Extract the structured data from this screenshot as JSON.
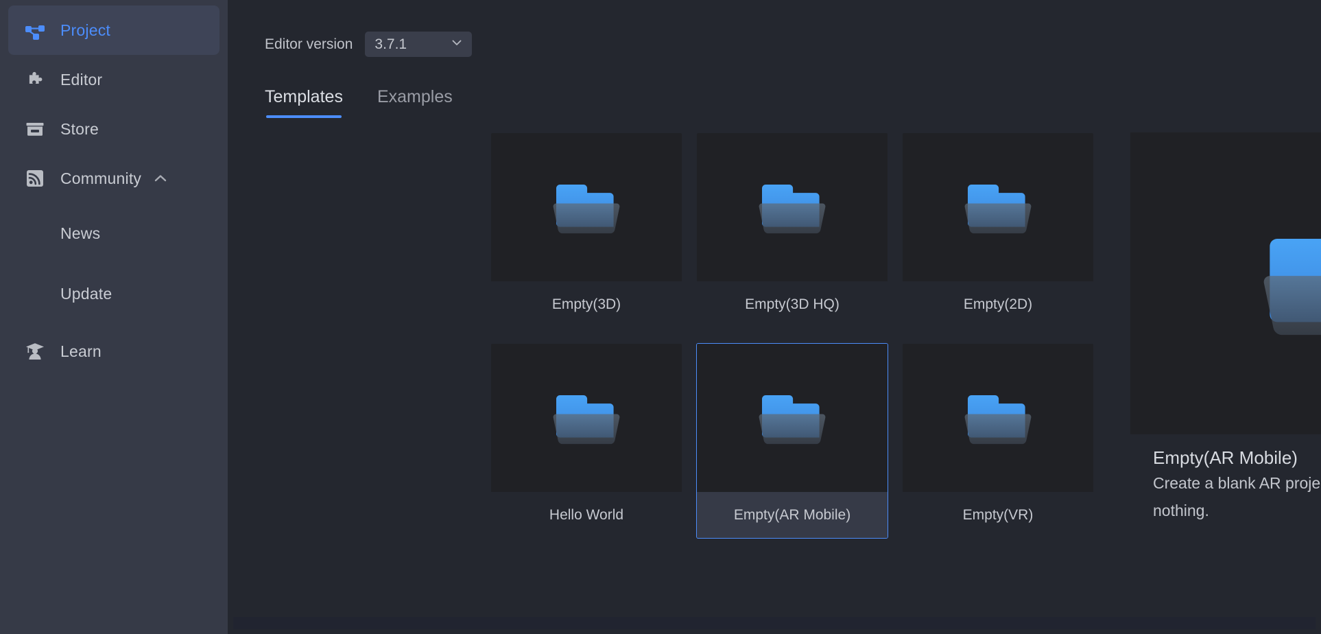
{
  "app": {
    "accent_color": "#4c8dfb",
    "sidebar_bg": "#363a47",
    "main_bg": "#24272f",
    "card_bg": "#202125"
  },
  "sidebar": {
    "items": [
      {
        "id": "project",
        "label": "Project",
        "icon": "node-graph-icon",
        "active": true,
        "sub": false
      },
      {
        "id": "editor",
        "label": "Editor",
        "icon": "puzzle-piece-icon",
        "active": false,
        "sub": false
      },
      {
        "id": "store",
        "label": "Store",
        "icon": "storefront-icon",
        "active": false,
        "sub": false
      },
      {
        "id": "community",
        "label": "Community",
        "icon": "rss-feed-icon",
        "active": false,
        "sub": false,
        "chevron": "chevron-up-icon"
      },
      {
        "id": "news",
        "label": "News",
        "icon": "",
        "active": false,
        "sub": true
      },
      {
        "id": "update",
        "label": "Update",
        "icon": "",
        "active": false,
        "sub": true
      },
      {
        "id": "learn",
        "label": "Learn",
        "icon": "graduate-icon",
        "active": false,
        "sub": false
      }
    ]
  },
  "toolbar": {
    "version_label": "Editor version",
    "version_value": "3.7.1",
    "version_chevron": "chevron-down-icon"
  },
  "tabs": [
    {
      "id": "templates",
      "label": "Templates",
      "active": true
    },
    {
      "id": "examples",
      "label": "Examples",
      "active": false
    }
  ],
  "templates": [
    {
      "id": "empty-3d",
      "label": "Empty(3D)",
      "icon": "folder-icon",
      "selected": false
    },
    {
      "id": "empty-3d-hq",
      "label": "Empty(3D HQ)",
      "icon": "folder-icon",
      "selected": false
    },
    {
      "id": "empty-2d",
      "label": "Empty(2D)",
      "icon": "folder-icon",
      "selected": false
    },
    {
      "id": "hello-world",
      "label": "Hello World",
      "icon": "folder-icon",
      "selected": false
    },
    {
      "id": "empty-ar-mobile",
      "label": "Empty(AR Mobile)",
      "icon": "folder-icon",
      "selected": true
    },
    {
      "id": "empty-vr",
      "label": "Empty(VR)",
      "icon": "folder-icon",
      "selected": false
    }
  ],
  "preview": {
    "icon": "folder-icon",
    "title": "Empty(AR Mobile)",
    "description": "Create a blank AR project that contains nothing."
  }
}
